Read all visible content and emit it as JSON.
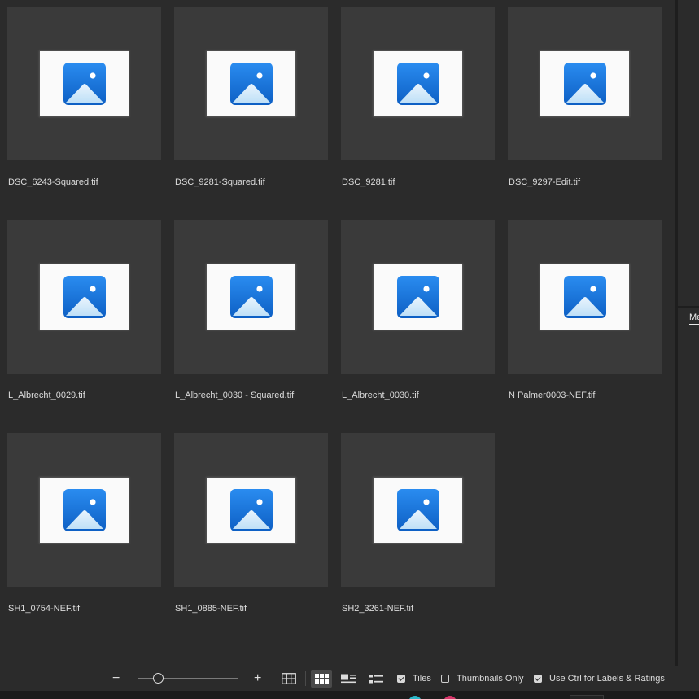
{
  "files": [
    {
      "name": "DSC_6243-Squared.tif"
    },
    {
      "name": "DSC_9281-Squared.tif"
    },
    {
      "name": "DSC_9281.tif"
    },
    {
      "name": "DSC_9297-Edit.tif"
    },
    {
      "name": "L_Albrecht_0029.tif"
    },
    {
      "name": "L_Albrecht_0030 - Squared.tif"
    },
    {
      "name": "L_Albrecht_0030.tif"
    },
    {
      "name": "N Palmer0003-NEF.tif"
    },
    {
      "name": "SH1_0754-NEF.tif"
    },
    {
      "name": "SH1_0885-NEF.tif"
    },
    {
      "name": "SH2_3261-NEF.tif"
    }
  ],
  "thumbnail_icon": "image-placeholder-icon",
  "side_panel": {
    "tab_label": "Me"
  },
  "toolbar": {
    "zoom_out_label": "−",
    "zoom_in_label": "+",
    "zoom_level": 0.2,
    "views": [
      {
        "icon": "grid-view-icon",
        "active": false
      },
      {
        "icon": "tiles-view-icon",
        "active": true
      },
      {
        "icon": "details-view-icon",
        "active": false
      },
      {
        "icon": "list-view-icon",
        "active": false
      }
    ],
    "tiles_label": "Tiles",
    "tiles_checked": true,
    "thumbnails_only_label": "Thumbnails Only",
    "thumbnails_only_checked": false,
    "ctrl_labels_label": "Use Ctrl for Labels & Ratings",
    "ctrl_labels_checked": true
  },
  "colors": {
    "background": "#2b2b2b",
    "tile": "#3a3a3a",
    "icon_blue": "#1a73d9"
  }
}
